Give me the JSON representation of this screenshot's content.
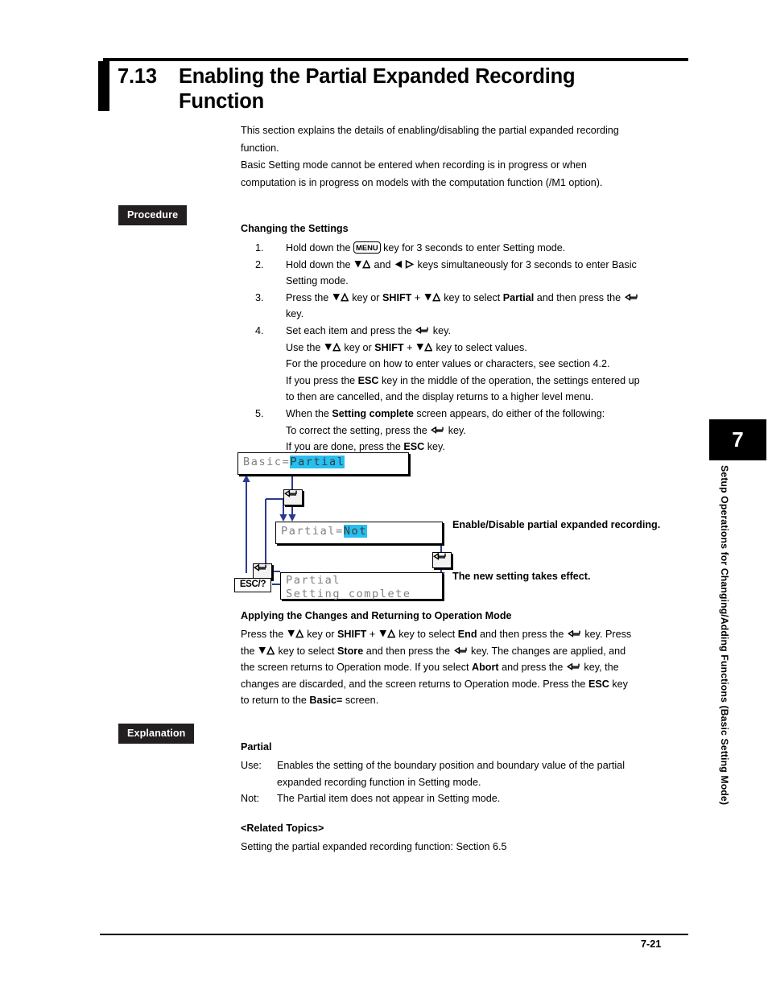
{
  "section": {
    "number": "7.13",
    "title": "Enabling the Partial Expanded Recording Function",
    "intro_line1": "This section explains the details of enabling/disabling the partial expanded recording",
    "intro_line2": "function.",
    "intro_line3": "Basic Setting mode cannot be entered when recording is in progress or when",
    "intro_line4": "computation is in progress on models with the computation function (/M1 option)."
  },
  "badges": {
    "procedure": "Procedure",
    "explanation": "Explanation"
  },
  "procedure": {
    "heading": "Changing the Settings",
    "steps": [
      {
        "number": "1.",
        "parts": [
          "Hold down the ",
          "MENU",
          " key for 3 seconds to enter Setting mode."
        ]
      },
      {
        "number": "2.",
        "text_a": "Hold down the ",
        "text_b": " and ",
        "text_c": " keys simultaneously for 3 seconds to enter Basic",
        "text_d": "Setting mode."
      },
      {
        "number": "3.",
        "text_a": "Press the ",
        "text_b": " key or ",
        "shift": "SHIFT",
        "text_c": " + ",
        "text_d": " key to select ",
        "target": "Partial",
        "text_e": " and then press the ",
        "text_f": "key."
      },
      {
        "number": "4.",
        "line1_a": "Set each item and press the ",
        "line1_b": " key.",
        "line2_a": "Use the ",
        "line2_b": " key or ",
        "line2_shift": "SHIFT",
        "line2_c": " + ",
        "line2_d": " key to select values.",
        "line3": "For the procedure on how to enter values or characters, see section 4.2.",
        "line4_a": "If you press the ",
        "line4_esc": "ESC",
        "line4_b": " key in the middle of the operation, the settings entered up",
        "line5": "to then are cancelled, and the display returns to a higher level menu."
      },
      {
        "number": "5.",
        "line1_a": "When the ",
        "line1_bold": "Setting complete",
        "line1_b": " screen appears, do either of the following:",
        "line2_a": "To correct the setting, press the ",
        "line2_b": " key.",
        "line3_a": "If you are done, press the ",
        "line3_esc": "ESC",
        "line3_b": " key."
      }
    ]
  },
  "diagram": {
    "screen1": {
      "prefix": "Basic=",
      "highlight": "Partial"
    },
    "screen2": {
      "prefix": "Partial=",
      "highlight": "Not"
    },
    "screen3": {
      "line1": "Partial",
      "line2": "Setting complete"
    },
    "esc_key_label": "ESC/?",
    "note1": "Enable/Disable partial expanded recording.",
    "note2": "The new setting takes effect.",
    "line_color": "#2b3a8f",
    "highlight_color": "#27bff0",
    "lcd_text_color": "#808080"
  },
  "applying": {
    "heading": "Applying the Changes and Returning to Operation Mode",
    "l1_a": "Press the ",
    "l1_b": " key or ",
    "l1_shift": "SHIFT",
    "l1_c": " + ",
    "l1_d": " key to select ",
    "l1_end": "End",
    "l1_e": " and then press the ",
    "l1_f": " key.  Press",
    "l2_a": "the ",
    "l2_b": " key to select ",
    "l2_store": "Store",
    "l2_c": " and then press the ",
    "l2_d": " key.  The changes are applied, and",
    "l3_a": "the screen returns to Operation mode.  If you select ",
    "l3_abort": "Abort",
    "l3_b": " and press the ",
    "l3_c": " key, the",
    "l4_a": "changes are discarded, and the screen returns to Operation mode.  Press the ",
    "l4_esc": "ESC",
    "l4_b": " key",
    "l5_a": "to return to the ",
    "l5_basic": "Basic=",
    "l5_b": " screen."
  },
  "explanation": {
    "heading": "Partial",
    "rows": [
      {
        "label": "Use:",
        "line1": "Enables the setting of the boundary position and boundary value of the partial",
        "line2": "expanded recording function in Setting mode."
      },
      {
        "label": "Not:",
        "line1": "The Partial item does not appear in Setting mode.",
        "line2": ""
      }
    ],
    "related_heading": "<Related Topics>",
    "related_body": "Setting the partial expanded recording function: Section 6.5"
  },
  "chapter_tab": {
    "number": "7",
    "label": "Setup Operations for Changing/Adding Functions (Basic Setting Mode)"
  },
  "footer": {
    "page_number": "7-21"
  }
}
